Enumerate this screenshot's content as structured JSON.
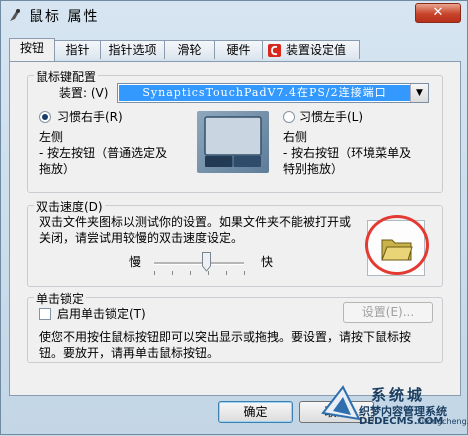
{
  "window": {
    "title": "鼠标 属性",
    "close_label": "✕"
  },
  "tabs": [
    {
      "label": "按钮",
      "active": true
    },
    {
      "label": "指针",
      "active": false
    },
    {
      "label": "指针选项",
      "active": false
    },
    {
      "label": "滑轮",
      "active": false
    },
    {
      "label": "硬件",
      "active": false
    },
    {
      "label": "装置设定值",
      "active": false
    }
  ],
  "button_config": {
    "title": "鼠标键配置",
    "device_label": "装置: (V)",
    "device_value": "SynapticsTouchPadV7.4在PS/2连接端口",
    "right_handed_label": "习惯右手(R)",
    "left_handed_label": "习惯左手(L)",
    "selected": "right",
    "left_side_title": "左侧",
    "left_side_desc": [
      "- 按左按钮（普通选定及",
      "拖放）"
    ],
    "right_side_title": "右侧",
    "right_side_desc": [
      "- 按右按钮（环境菜单及",
      "特别拖放）"
    ]
  },
  "double_click": {
    "title": "双击速度(D)",
    "desc": [
      "双击文件夹图标以测试你的设置。如果文件夹不能被打开或",
      "关闭，请尝试用较慢的双击速度设定。"
    ],
    "slow_label": "慢",
    "fast_label": "快",
    "speed_fraction": 0.55
  },
  "click_lock": {
    "title": "单击锁定",
    "checkbox_label": "启用单击锁定(T)",
    "checked": false,
    "settings_label": "设置(E)...",
    "desc": [
      "使您不用按住鼠标按钮即可以突出显示或拖拽。要设置，请按下鼠标按",
      "钮。要放开，请再单击鼠标按钮。"
    ]
  },
  "footer": {
    "ok_label": "确定",
    "cancel_label": "取消"
  },
  "watermark": {
    "brand": "系统城",
    "line1": "织梦内容管理系统",
    "line2": "DEDECMS.COM",
    "line3": "xitongcheng.com"
  },
  "colors": {
    "selection": "#3399ff",
    "close": "#c7432a",
    "highlight_circle": "#e33b33"
  }
}
